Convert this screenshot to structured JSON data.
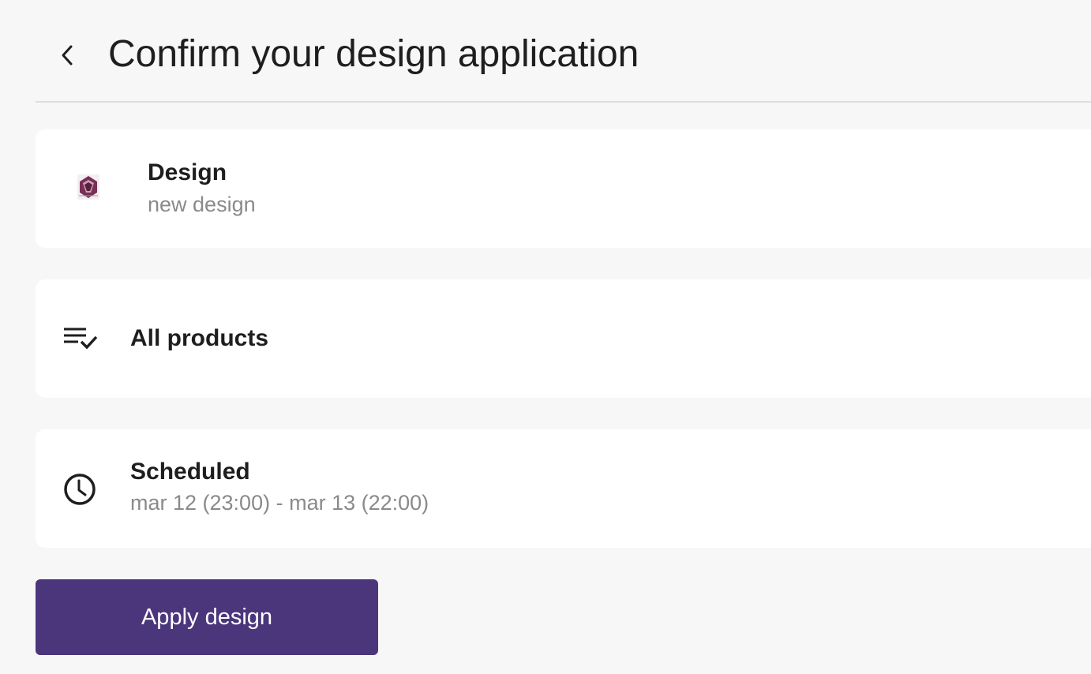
{
  "header": {
    "title": "Confirm your design application",
    "back_icon": "chevron-left-icon"
  },
  "design_card": {
    "title": "Design",
    "subtitle": "new design",
    "thumbnail_icon": "design-thumbnail-icon"
  },
  "products_card": {
    "title": "All products",
    "icon": "playlist-check-icon"
  },
  "schedule_card": {
    "title": "Scheduled",
    "subtitle": "mar 12 (23:00) - mar 13 (22:00)",
    "icon": "clock-icon"
  },
  "actions": {
    "apply_label": "Apply design"
  },
  "colors": {
    "background": "#f7f7f7",
    "card": "#ffffff",
    "primary_button": "#4b367c",
    "secondary_text": "#8a8a8a"
  }
}
